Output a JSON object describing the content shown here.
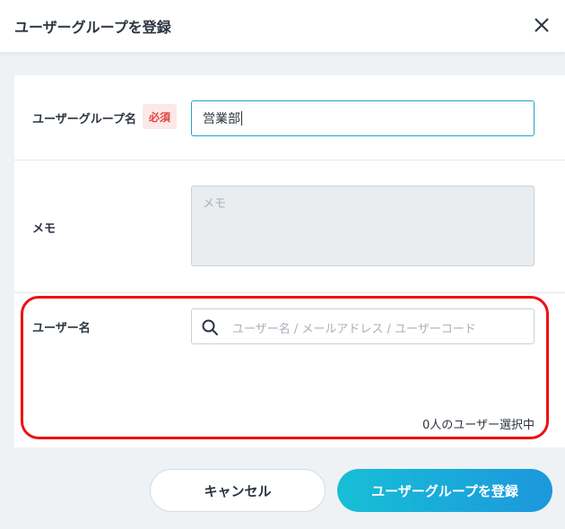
{
  "dialog": {
    "title": "ユーザーグループを登録"
  },
  "form": {
    "group_name": {
      "label": "ユーザーグループ名",
      "required_badge": "必須",
      "value": "営業部"
    },
    "memo": {
      "label": "メモ",
      "placeholder": "メモ"
    },
    "users": {
      "label": "ユーザー名",
      "search_placeholder": "ユーザー名 / メールアドレス / ユーザーコード",
      "selected_count": "0人のユーザー選択中"
    }
  },
  "footer": {
    "cancel_label": "キャンセル",
    "submit_label": "ユーザーグループを登録"
  },
  "colors": {
    "accent": "#1da4c8",
    "required": "#e0453a",
    "highlight": "#ee1111"
  },
  "icons": {
    "close": "close-icon",
    "search": "search-icon"
  }
}
